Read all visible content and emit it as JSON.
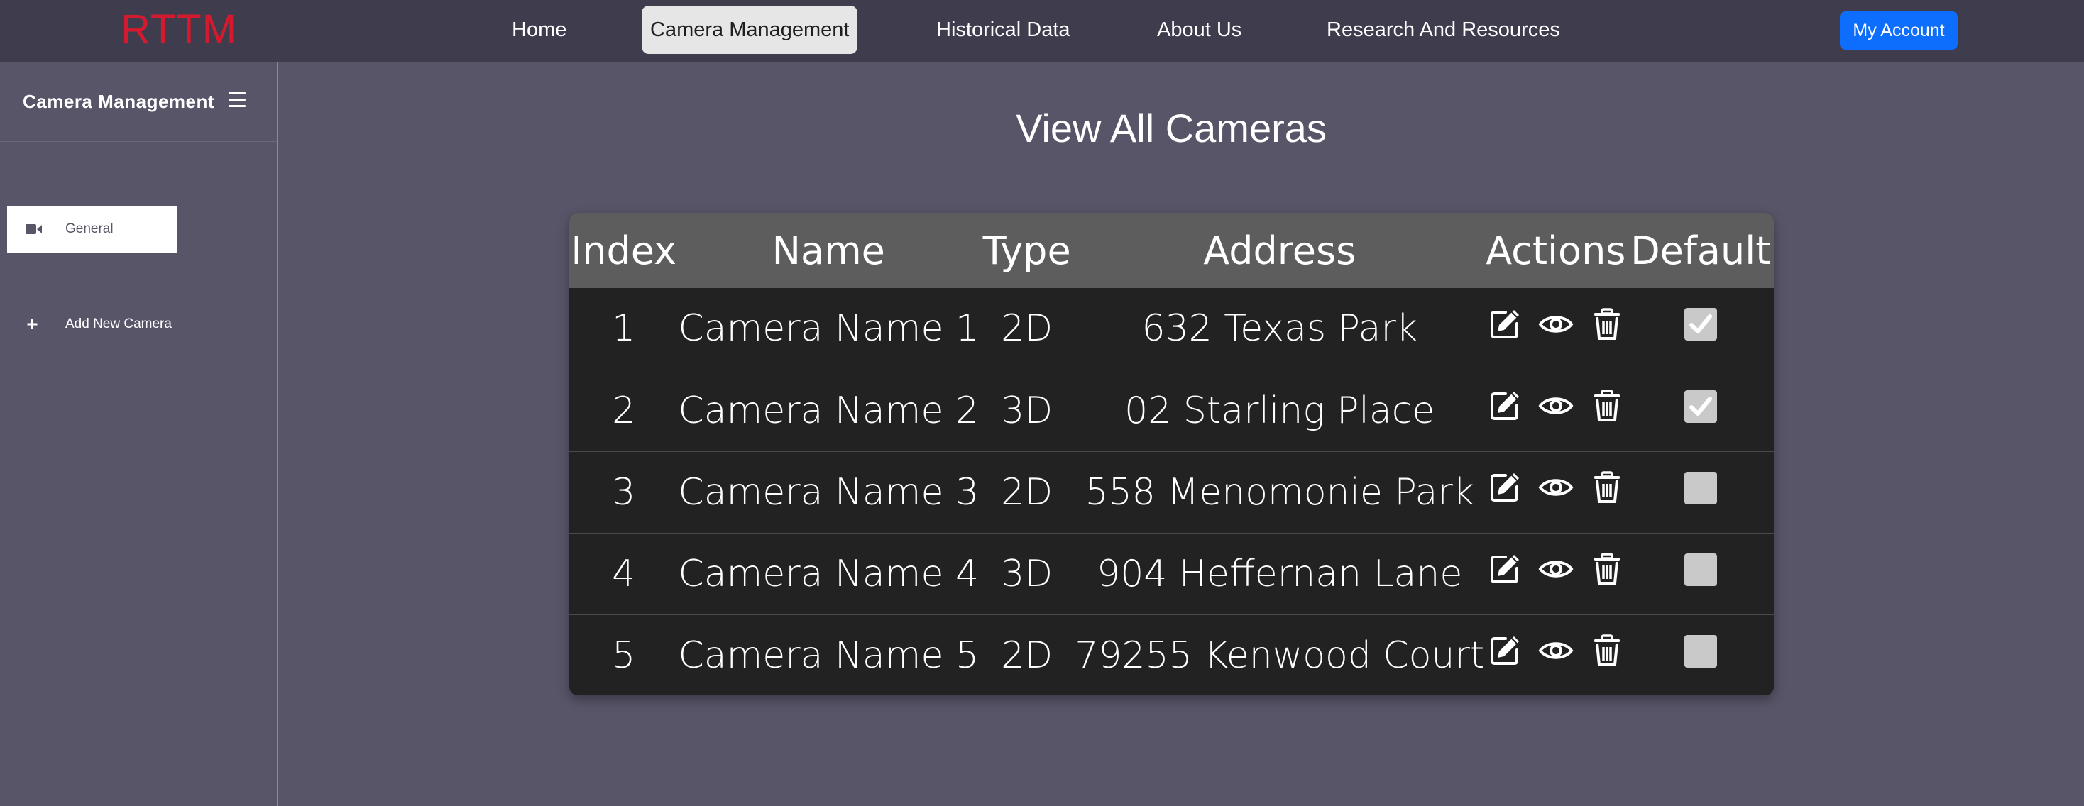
{
  "brand": "RTTM",
  "nav": {
    "links": [
      {
        "label": "Home",
        "active": false
      },
      {
        "label": "Camera Management",
        "active": true
      },
      {
        "label": "Historical Data",
        "active": false
      },
      {
        "label": "About Us",
        "active": false
      },
      {
        "label": "Research And Resources",
        "active": false
      }
    ],
    "account_label": "My Account"
  },
  "sidebar": {
    "title": "Camera Management",
    "items": [
      {
        "label": "General",
        "icon": "video-camera-icon",
        "active": true
      },
      {
        "label": "Add New Camera",
        "icon": "plus-icon",
        "active": false
      }
    ]
  },
  "main": {
    "title": "View All Cameras",
    "table": {
      "headers": [
        "Index",
        "Name",
        "Type",
        "Address",
        "Actions",
        "Default"
      ],
      "rows": [
        {
          "index": "1",
          "name": "Camera Name 1",
          "type": "2D",
          "address": "632 Texas Park",
          "default": true
        },
        {
          "index": "2",
          "name": "Camera Name 2",
          "type": "3D",
          "address": "02 Starling Place",
          "default": true
        },
        {
          "index": "3",
          "name": "Camera Name 3",
          "type": "2D",
          "address": "558 Menomonie Park",
          "default": false
        },
        {
          "index": "4",
          "name": "Camera Name 4",
          "type": "3D",
          "address": "904 Heffernan Lane",
          "default": false
        },
        {
          "index": "5",
          "name": "Camera Name 5",
          "type": "2D",
          "address": "79255 Kenwood Court",
          "default": false
        }
      ],
      "action_icons": [
        "edit-icon",
        "view-eye-icon",
        "delete-trash-icon"
      ]
    }
  },
  "colors": {
    "brand": "#d41a2f",
    "navbar_bg": "#3f3c4d",
    "page_bg": "#595569",
    "account_button": "#0d6efd",
    "table_bg": "#222222",
    "table_header_bg": "#5d5d5d"
  }
}
